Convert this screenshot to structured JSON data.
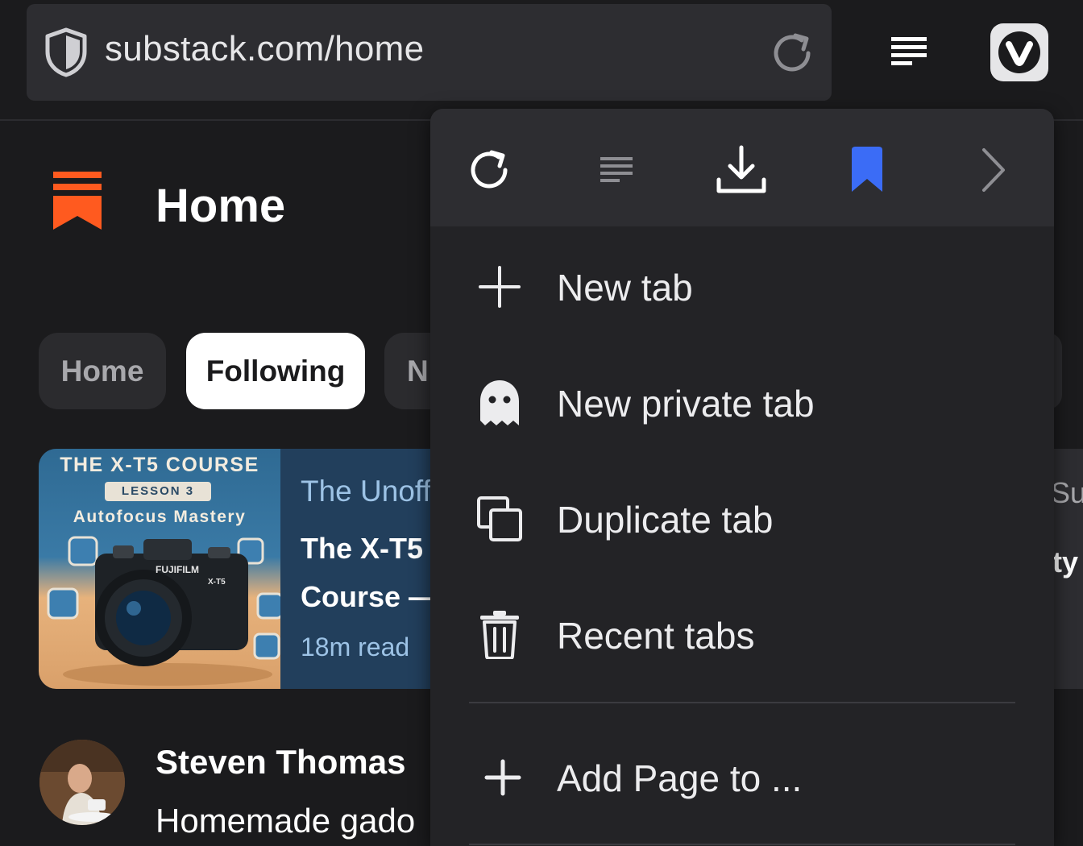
{
  "address_bar": {
    "url": "substack.com/home"
  },
  "page": {
    "title": "Home",
    "tabs": [
      "Home",
      "Following",
      "N"
    ],
    "featured": {
      "course_title": "THE X-T5 COURSE",
      "lesson": "LESSON 3",
      "subtitle": "Autofocus Mastery",
      "camera_brand": "FUJIFILM",
      "camera_model": "X-T5",
      "publication": "The Unoff",
      "post_title_line1": "The X-T5",
      "post_title_line2": "Course —",
      "read_time": "18m read"
    },
    "right_card": {
      "text1": "Su",
      "text2": "ity"
    },
    "post": {
      "author": "Steven Thomas",
      "excerpt": "Homemade gado"
    }
  },
  "menu": {
    "toolbar": [
      {
        "icon": "reload-icon"
      },
      {
        "icon": "reader-view-icon"
      },
      {
        "icon": "download-icon"
      },
      {
        "icon": "bookmark-icon",
        "color": "#3b6cf6"
      },
      {
        "icon": "chevron-right-icon"
      }
    ],
    "items": [
      {
        "label": "New tab",
        "icon": "plus-icon"
      },
      {
        "label": "New private tab",
        "icon": "ghost-icon"
      },
      {
        "label": "Duplicate tab",
        "icon": "duplicate-icon"
      },
      {
        "label": "Recent tabs",
        "icon": "trash-icon"
      },
      {
        "label": "Add Page to ...",
        "icon": "plus-icon"
      }
    ]
  },
  "colors": {
    "background": "#1b1b1d",
    "menu_bg": "#232326",
    "accent_substack": "#ff5a1f",
    "bookmark_blue": "#3b6cf6"
  }
}
